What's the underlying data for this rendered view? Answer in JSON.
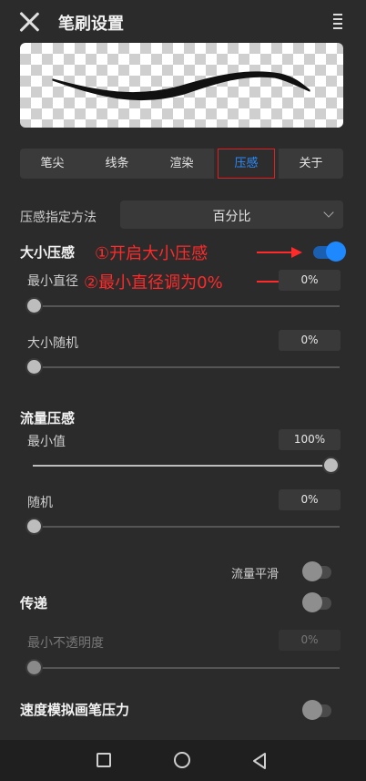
{
  "header": {
    "title": "笔刷设置",
    "close_icon": "close-icon",
    "menu_icon": "menu-icon"
  },
  "tabs": [
    {
      "label": "笔尖",
      "active": false
    },
    {
      "label": "线条",
      "active": false
    },
    {
      "label": "渲染",
      "active": false
    },
    {
      "label": "压感",
      "active": true
    },
    {
      "label": "关于",
      "active": false
    }
  ],
  "pressure_method": {
    "label": "压感指定方法",
    "value": "百分比"
  },
  "size_pressure": {
    "title": "大小压感",
    "enabled": true,
    "min_diameter": {
      "label": "最小直径",
      "value": "0%",
      "level": 0
    },
    "size_random": {
      "label": "大小随机",
      "value": "0%",
      "level": 0
    }
  },
  "flow_pressure": {
    "title": "流量压感",
    "min_value": {
      "label": "最小值",
      "value": "100%",
      "level": 1
    },
    "random": {
      "label": "随机",
      "value": "0%",
      "level": 0
    },
    "flow_smooth": {
      "label": "流量平滑",
      "enabled": false
    }
  },
  "transfer": {
    "title": "传递",
    "enabled": false,
    "min_opacity": {
      "label": "最小不透明度",
      "value": "0%",
      "level": 0
    }
  },
  "speed_sim": {
    "title": "速度模拟画笔压力",
    "enabled": false
  },
  "annotations": {
    "note1": "①开启大小压感",
    "note2": "②最小直径调为0%"
  },
  "colors": {
    "accent": "#1e88ff",
    "annotation_red": "#ff2a2a",
    "background": "#2b2b2b"
  },
  "navbar": {
    "icons": [
      "recents-square-icon",
      "home-circle-icon",
      "back-triangle-icon"
    ]
  }
}
